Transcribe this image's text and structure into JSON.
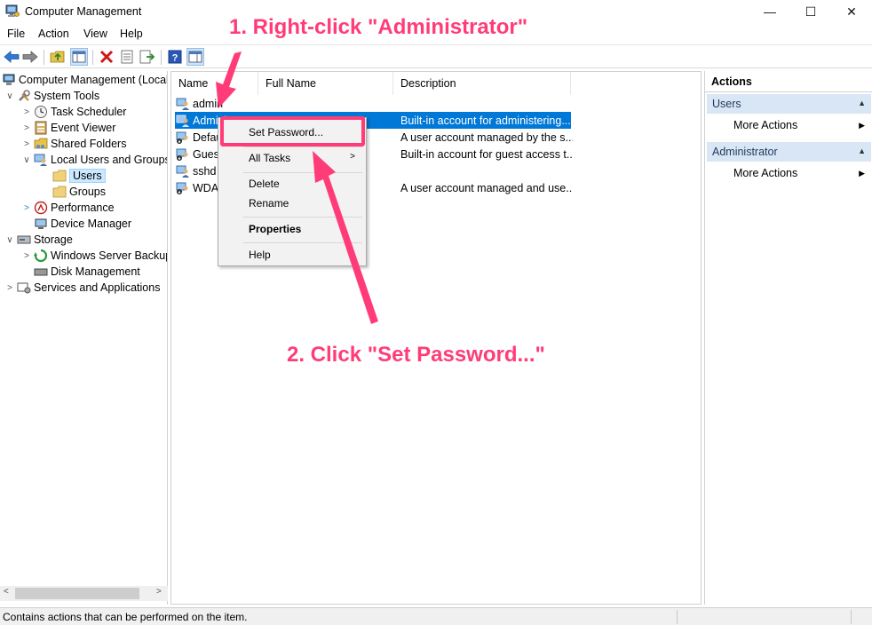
{
  "window": {
    "title": "Computer Management",
    "controls": {
      "minimize": "—",
      "maximize": "☐",
      "close": "✕"
    }
  },
  "menubar": [
    "File",
    "Action",
    "View",
    "Help"
  ],
  "toolbar": {
    "icons": [
      "back-arrow-icon",
      "forward-arrow-icon",
      "up-folder-icon",
      "show-hide-tree-icon",
      "delete-icon",
      "properties-icon",
      "export-list-icon",
      "help-icon",
      "show-hide-action-pane-icon"
    ]
  },
  "tree": {
    "items": [
      {
        "label": "Computer Management (Local",
        "level": 0,
        "arrow": ""
      },
      {
        "label": "System Tools",
        "level": 1,
        "arrow": "∨"
      },
      {
        "label": "Task Scheduler",
        "level": 2,
        "arrow": ">"
      },
      {
        "label": "Event Viewer",
        "level": 2,
        "arrow": ">"
      },
      {
        "label": "Shared Folders",
        "level": 2,
        "arrow": ">"
      },
      {
        "label": "Local Users and Groups",
        "level": 2,
        "arrow": "∨"
      },
      {
        "label": "Users",
        "level": 3,
        "arrow": "",
        "selected": true
      },
      {
        "label": "Groups",
        "level": 3,
        "arrow": ""
      },
      {
        "label": "Performance",
        "level": 2,
        "arrow": ">"
      },
      {
        "label": "Device Manager",
        "level": 2,
        "arrow": ""
      },
      {
        "label": "Storage",
        "level": 1,
        "arrow": "∨"
      },
      {
        "label": "Windows Server Backup",
        "level": 2,
        "arrow": ">"
      },
      {
        "label": "Disk Management",
        "level": 2,
        "arrow": ""
      },
      {
        "label": "Services and Applications",
        "level": 1,
        "arrow": ">"
      }
    ]
  },
  "list": {
    "columns": [
      "Name",
      "Full Name",
      "Description"
    ],
    "rows": [
      {
        "name": "admin",
        "description": ""
      },
      {
        "name": "Administrator",
        "description": "Built-in account for administering...",
        "selected": true
      },
      {
        "name": "DefaultAccount",
        "description": "A user account managed by the s..."
      },
      {
        "name": "Guest",
        "description": "Built-in account for guest access t..."
      },
      {
        "name": "sshd",
        "description": ""
      },
      {
        "name": "WDAGUtilityAccount",
        "description": "A user account managed and use..."
      }
    ]
  },
  "actions": {
    "title": "Actions",
    "sections": [
      {
        "label": "Users",
        "item": "More Actions"
      },
      {
        "label": "Administrator",
        "item": "More Actions"
      }
    ]
  },
  "context_menu": {
    "set_password": "Set Password...",
    "all_tasks": "All Tasks",
    "delete": "Delete",
    "rename": "Rename",
    "properties": "Properties",
    "help": "Help"
  },
  "annotations": {
    "step1": "1. Right-click \"Administrator\"",
    "step2": "2. Click \"Set Password...\"",
    "color": "#ff3c78"
  },
  "statusbar": {
    "text": "Contains actions that can be performed on the item."
  }
}
